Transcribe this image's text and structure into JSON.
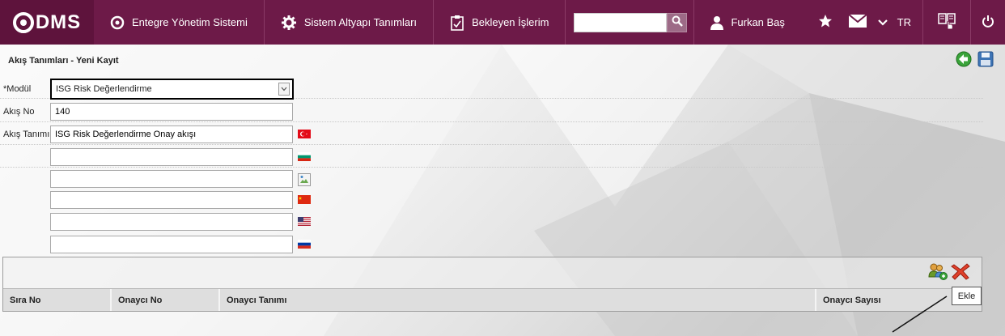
{
  "header": {
    "logo_text": "DMS",
    "nav": [
      {
        "label": "Entegre Yönetim Sistemi",
        "icon": "q-logo-icon"
      },
      {
        "label": "Sistem Altyapı Tanımları",
        "icon": "gear-icon"
      },
      {
        "label": "Bekleyen İşlerim",
        "icon": "clipboard-icon"
      }
    ],
    "search": {
      "value": "",
      "placeholder": ""
    },
    "user_name": "Furkan Baş",
    "language": "TR"
  },
  "page": {
    "title": "Akış Tanımları - Yeni Kayıt"
  },
  "form": {
    "modul_label": "*Modül",
    "modul_value": "ISG Risk Değerlendirme",
    "akis_no_label": "Akış No",
    "akis_no_value": "140",
    "akis_tanimi_label": "Akış Tanımı",
    "translations": [
      {
        "lang": "tr",
        "value": "ISG Risk Değerlendirme Onay akışı"
      },
      {
        "lang": "bg",
        "value": ""
      },
      {
        "lang": "broken",
        "value": ""
      },
      {
        "lang": "cn",
        "value": ""
      },
      {
        "lang": "us",
        "value": ""
      },
      {
        "lang": "ru",
        "value": ""
      }
    ]
  },
  "grid": {
    "columns": [
      "Sıra No",
      "Onaycı No",
      "Onaycı Tanımı",
      "Onaycı Sayısı"
    ]
  },
  "tooltip": "Ekle",
  "colors": {
    "topbar": "#6d1a48",
    "logo_bg": "#5e133c"
  }
}
